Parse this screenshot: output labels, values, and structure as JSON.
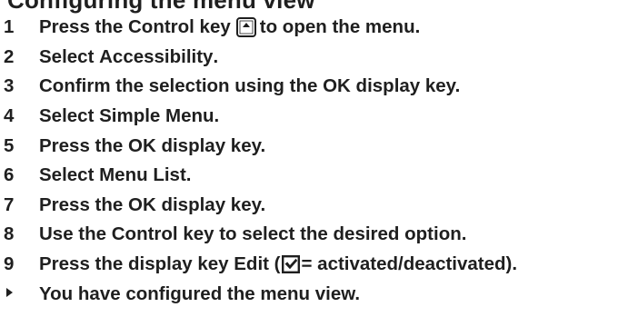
{
  "heading": "Configuring the menu view",
  "steps": [
    {
      "num": "1",
      "pre": "Press the Control key",
      "post": "to open the menu."
    },
    {
      "num": "2",
      "pre": "Select",
      "bold": "Accessibility",
      "post": "."
    },
    {
      "num": "3",
      "pre": "Confirm the selection using the",
      "bold": "OK",
      "post": "display key."
    },
    {
      "num": "4",
      "pre": "Select",
      "bold": "Simple Menu",
      "post": "."
    },
    {
      "num": "5",
      "pre": "Press the",
      "bold": "OK",
      "post": "display key."
    },
    {
      "num": "6",
      "pre": "Select",
      "bold": "Menu List",
      "post": "."
    },
    {
      "num": "7",
      "pre": "Press the",
      "bold": "OK",
      "post": "display key."
    },
    {
      "num": "8",
      "pre": "Use the Control key to select the desired option."
    },
    {
      "num": "9",
      "pre": "Press the display key",
      "bold": "Edit",
      "open": "(",
      "post": "= activated/deactivated)."
    }
  ],
  "result": {
    "marker_icon": "triangle-right-icon",
    "text": "You have configured the menu view."
  },
  "icons": {
    "control_key": "control-key-icon",
    "checkbox": "checked-box-icon"
  }
}
